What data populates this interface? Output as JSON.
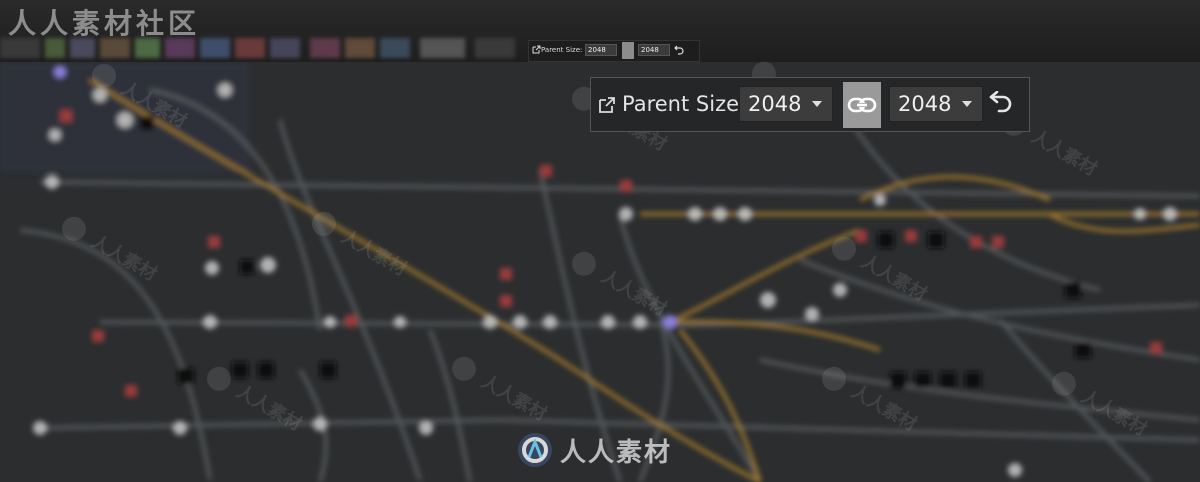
{
  "watermark": {
    "title": "人人素材社区",
    "brand": "人人素材",
    "stamp": "人人素材"
  },
  "toolbar_small": {
    "label": "Parent Size:",
    "width_value": "2048",
    "height_value": "2048",
    "icons": [
      "external-link-icon",
      "link-icon",
      "reset-icon"
    ]
  },
  "parent_size_panel": {
    "label": "Parent Size:",
    "width_value": "2048",
    "height_value": "2048",
    "link_active": true,
    "icons": [
      "external-link-icon",
      "chevron-down-icon",
      "link-icon",
      "reset-icon"
    ]
  },
  "colors": {
    "canvas": "#2b2d2f",
    "panel": "#252627",
    "dropdown": "#3c3c3c",
    "link_active": "#9a9a9a",
    "wire_orange": "#b8862a",
    "wire_gray": "#6d7173"
  }
}
